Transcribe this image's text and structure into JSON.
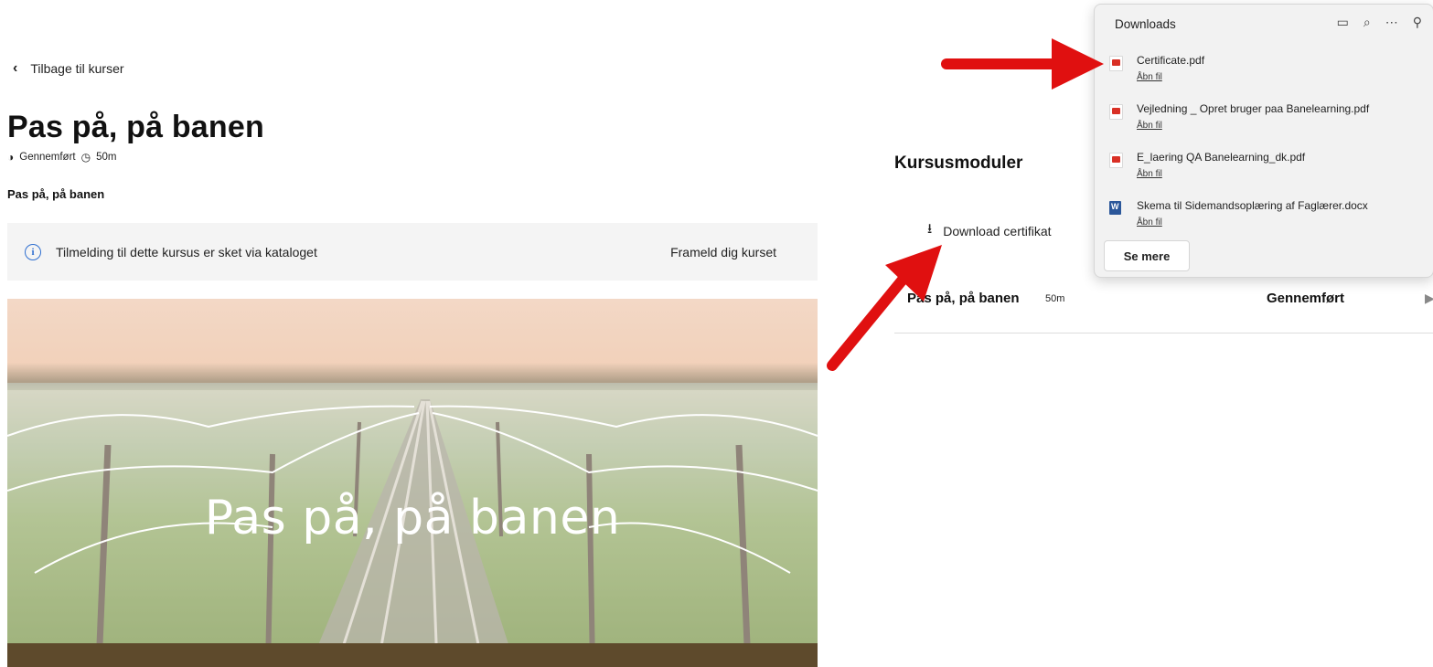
{
  "nav": {
    "back_label": "Tilbage til kurser"
  },
  "course": {
    "title": "Pas på, på banen",
    "status": "Gennemført",
    "duration": "50m",
    "subtitle": "Pas på, på banen"
  },
  "info_bar": {
    "message": "Tilmelding til dette kursus er sket via kataloget",
    "unenroll_label": "Frameld dig kurset"
  },
  "hero": {
    "title": "Pas på, på banen"
  },
  "modules": {
    "heading": "Kursusmoduler",
    "download_certificate_label": "Download certifikat",
    "items": [
      {
        "name": "Pas på, på banen",
        "duration": "50m",
        "status": "Gennemført"
      }
    ]
  },
  "downloads_panel": {
    "title": "Downloads",
    "items": [
      {
        "filename": "Certificate.pdf",
        "action": "Åbn fil",
        "type": "pdf"
      },
      {
        "filename": "Vejledning _ Opret bruger paa Banelearning.pdf",
        "action": "Åbn fil",
        "type": "pdf"
      },
      {
        "filename": "E_laering QA Banelearning_dk.pdf",
        "action": "Åbn fil",
        "type": "pdf"
      },
      {
        "filename": "Skema til Sidemandsoplæring af Faglærer.docx",
        "action": "Åbn fil",
        "type": "docx"
      }
    ],
    "see_more_label": "Se mere"
  },
  "colors": {
    "annotation_arrow": "#e01010",
    "info_icon": "#2f6fd0",
    "pdf_icon": "#d93025",
    "docx_icon": "#2b579a"
  },
  "icons": [
    "chevron-left-icon",
    "status-half-circle-icon",
    "clock-icon",
    "info-icon",
    "download-icon",
    "folder-icon",
    "search-icon",
    "more-icon",
    "pin-icon"
  ]
}
